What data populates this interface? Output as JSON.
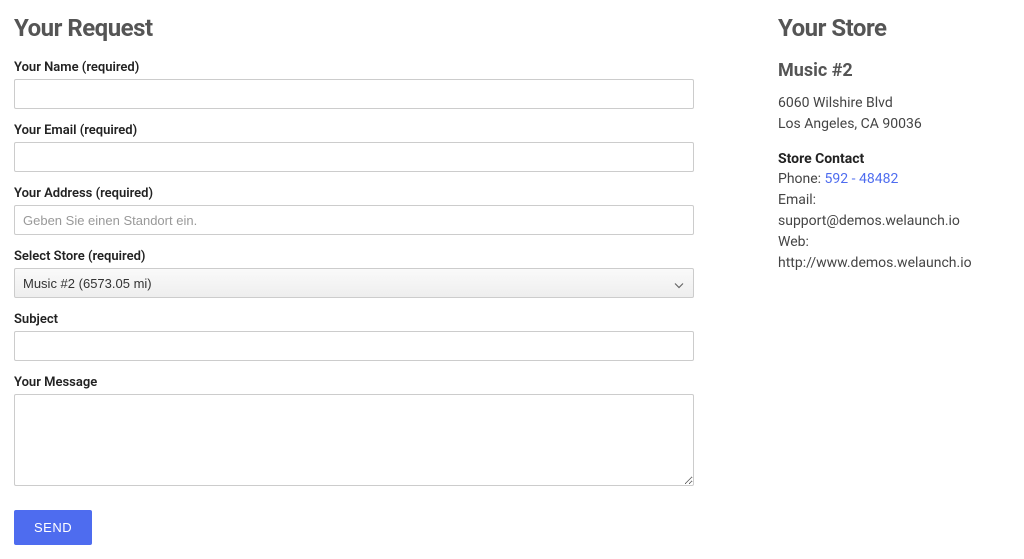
{
  "request": {
    "heading": "Your Request",
    "fields": {
      "name": {
        "label": "Your Name (required)"
      },
      "email": {
        "label": "Your Email (required)"
      },
      "address": {
        "label": "Your Address (required)",
        "placeholder": "Geben Sie einen Standort ein."
      },
      "store": {
        "label": "Select Store (required)",
        "selected": "Music #2 (6573.05 mi)"
      },
      "subject": {
        "label": "Subject"
      },
      "message": {
        "label": "Your Message"
      }
    },
    "submit_label": "SEND"
  },
  "store": {
    "heading": "Your Store",
    "name": "Music #2",
    "address_line1": "6060 Wilshire Blvd",
    "address_line2": "Los Angeles, CA 90036",
    "contact_heading": "Store Contact",
    "phone_label": "Phone: ",
    "phone_value": "592 - 48482",
    "email_label": "Email: ",
    "email_value": "support@demos.welaunch.io",
    "web_label": "Web: ",
    "web_value": "http://www.demos.welaunch.io"
  }
}
